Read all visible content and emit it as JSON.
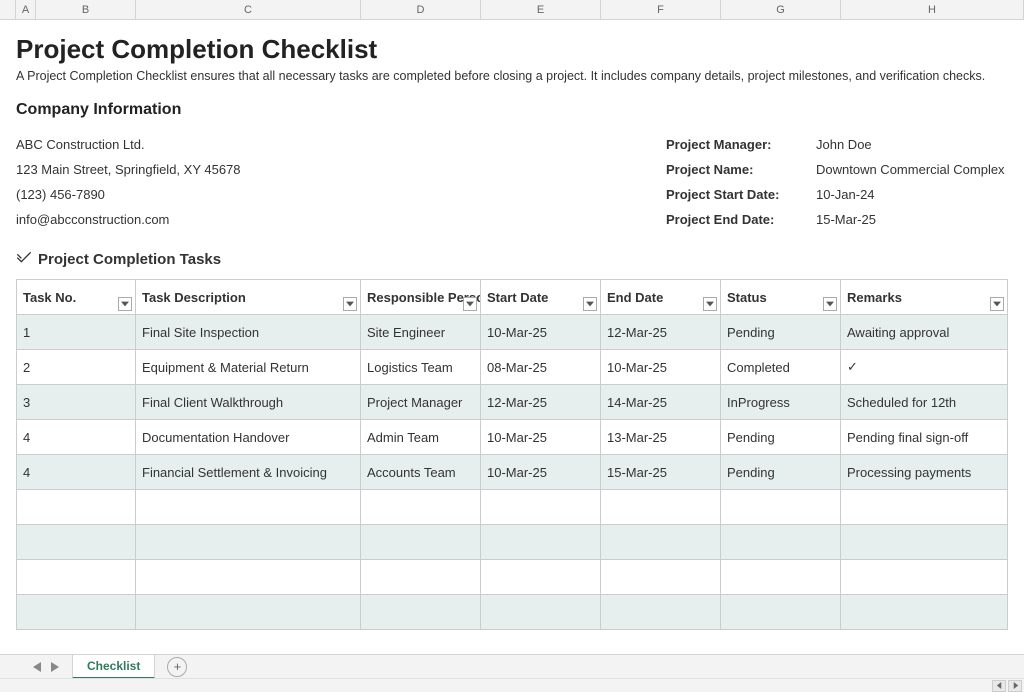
{
  "columns": [
    "A",
    "B",
    "C",
    "D",
    "E",
    "F",
    "G",
    "H"
  ],
  "title": "Project Completion Checklist",
  "subtitle": "A Project Completion Checklist ensures that all necessary tasks are completed before closing a project. It includes company details, project milestones, and verification checks.",
  "section_company": "Company Information",
  "company": {
    "name": "ABC Construction Ltd.",
    "address": "123 Main Street, Springfield, XY 45678",
    "phone": "(123) 456-7890",
    "email": "info@abcconstruction.com"
  },
  "project_info": [
    {
      "label": "Project Manager:",
      "value": "John Doe"
    },
    {
      "label": "Project Name:",
      "value": "Downtown Commercial Complex"
    },
    {
      "label": "Project Start Date:",
      "value": "10-Jan-24"
    },
    {
      "label": "Project End Date:",
      "value": "15-Mar-25"
    }
  ],
  "tasks_heading": "Project Completion Tasks",
  "table_headers": [
    "Task No.",
    "Task Description",
    "Responsible Person",
    "Start Date",
    "End Date",
    "Status",
    "Remarks"
  ],
  "tasks": [
    {
      "no": "1",
      "desc": "Final Site Inspection",
      "resp": "Site Engineer",
      "start": "10-Mar-25",
      "end": "12-Mar-25",
      "status": "Pending",
      "remarks": "Awaiting approval"
    },
    {
      "no": "2",
      "desc": "Equipment & Material Return",
      "resp": "Logistics Team",
      "start": "08-Mar-25",
      "end": "10-Mar-25",
      "status": "Completed",
      "remarks": "✓"
    },
    {
      "no": "3",
      "desc": "Final Client Walkthrough",
      "resp": "Project Manager",
      "start": "12-Mar-25",
      "end": "14-Mar-25",
      "status": "InProgress",
      "remarks": "Scheduled for 12th"
    },
    {
      "no": "4",
      "desc": "Documentation Handover",
      "resp": "Admin Team",
      "start": "10-Mar-25",
      "end": "13-Mar-25",
      "status": "Pending",
      "remarks": "Pending final sign-off"
    },
    {
      "no": "4",
      "desc": "Financial Settlement & Invoicing",
      "resp": "Accounts Team",
      "start": "10-Mar-25",
      "end": "15-Mar-25",
      "status": "Pending",
      "remarks": "Processing payments"
    },
    {
      "no": "",
      "desc": "",
      "resp": "",
      "start": "",
      "end": "",
      "status": "",
      "remarks": ""
    },
    {
      "no": "",
      "desc": "",
      "resp": "",
      "start": "",
      "end": "",
      "status": "",
      "remarks": ""
    },
    {
      "no": "",
      "desc": "",
      "resp": "",
      "start": "",
      "end": "",
      "status": "",
      "remarks": ""
    },
    {
      "no": "",
      "desc": "",
      "resp": "",
      "start": "",
      "end": "",
      "status": "",
      "remarks": ""
    }
  ],
  "sheet_tab": "Checklist"
}
